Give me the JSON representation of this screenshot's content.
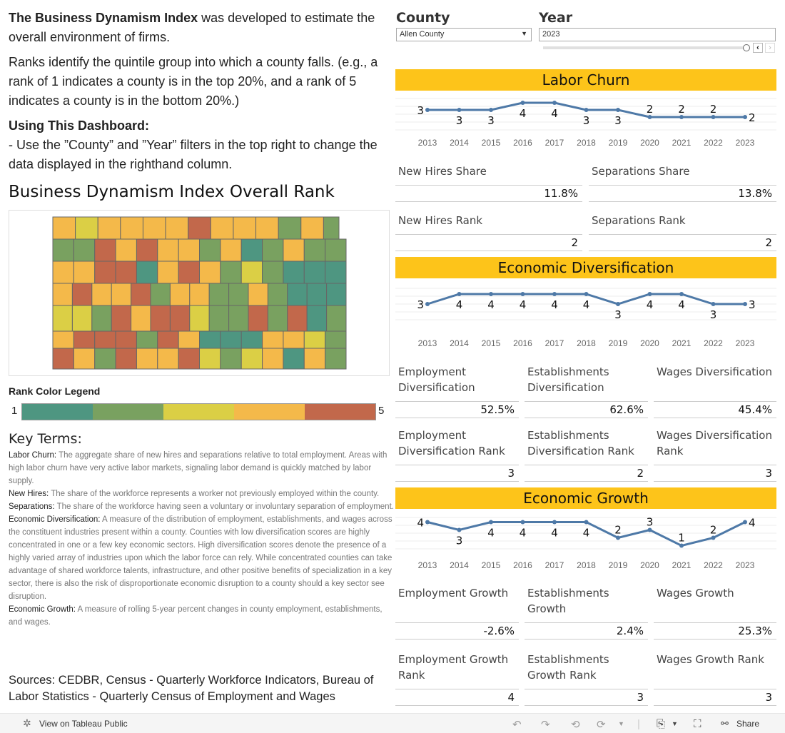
{
  "intro": {
    "p1_bold": "The Business Dynamism Index",
    "p1_rest": " was developed to estimate the overall environment of firms.",
    "p2": "Ranks identify the quintile group into which a county falls. (e.g., a rank of 1 indicates a county is in the top 20%, and a rank of 5 indicates a county is in the bottom 20%.)",
    "p3_bold": "Using This Dashboard:",
    "p3": "- Use the ”County” and ”Year” filters in the top right to change the data displayed in the righthand column."
  },
  "map": {
    "title": "Business Dynamism Index Overall Rank",
    "county_ranks_by_row": [
      [
        4,
        3,
        4,
        4,
        4,
        4,
        5,
        4,
        4,
        4,
        2,
        4,
        2
      ],
      [
        2,
        2,
        5,
        4,
        5,
        4,
        4,
        2,
        4,
        1,
        2,
        4,
        2,
        2
      ],
      [
        4,
        4,
        5,
        5,
        1,
        4,
        5,
        4,
        2,
        3,
        2,
        1,
        1,
        1
      ],
      [
        4,
        5,
        4,
        4,
        5,
        2,
        4,
        4,
        2,
        2,
        4,
        2,
        1,
        1,
        1
      ],
      [
        3,
        3,
        2,
        5,
        4,
        5,
        5,
        3,
        2,
        2,
        5,
        2,
        5,
        1,
        2
      ],
      [
        4,
        5,
        5,
        5,
        2,
        5,
        4,
        1,
        1,
        1,
        4,
        4,
        3,
        2
      ],
      [
        5,
        4,
        2,
        5,
        4,
        4,
        5,
        3,
        2,
        3,
        4,
        1,
        4,
        2
      ]
    ]
  },
  "legend": {
    "title": "Rank Color Legend",
    "low": "1",
    "high": "5",
    "colors": {
      "1": "#4e9681",
      "2": "#79a160",
      "3": "#dbcf45",
      "4": "#f4b94a",
      "5": "#c2684b"
    }
  },
  "key_terms": {
    "title": "Key Terms:",
    "items": [
      {
        "term": "Labor Churn:",
        "def": " The aggregate share of new hires and separations relative to total employment. Areas with high labor churn have very active labor markets, signaling labor demand is quickly matched by labor supply."
      },
      {
        "term": "New Hires:",
        "def": " The share of the workforce represents a worker not previously employed within the county."
      },
      {
        "term": "Separations:",
        "def": " The share of the workforce having seen a voluntary or involuntary separation of employment."
      },
      {
        "term": "Economic Diversification:",
        "def": " A measure of the distribution of employment, establishments, and wages across the constituent industries present within a county. Counties with low diversification scores are highly concentrated in one or a few key economic sectors. High diversification scores denote the presence of a highly varied array of industries upon which the labor force can rely. While concentrated counties can take advantage of shared workforce talents, infrastructure, and other positive benefits of specialization in a key sector, there is also the risk of disproportionate economic disruption to a county should a key sector see disruption."
      },
      {
        "term": "Economic Growth:",
        "def": " A measure of rolling 5-year percent changes in county employment, establishments, and wages."
      }
    ]
  },
  "sources": "Sources: CEDBR, Census - Quarterly Workforce Indicators, Bureau of Labor Statistics - Quarterly Census of Employment and Wages",
  "filters": {
    "county_label": "County",
    "county_value": "Allen County",
    "year_label": "Year",
    "year_value": "2023"
  },
  "years": [
    "2013",
    "2014",
    "2015",
    "2016",
    "2017",
    "2018",
    "2019",
    "2020",
    "2021",
    "2022",
    "2023"
  ],
  "line_color": "#4e79a7",
  "sections": {
    "churn": {
      "title": "Labor Churn",
      "ranks": [
        3,
        3,
        3,
        4,
        4,
        3,
        3,
        2,
        2,
        2,
        2
      ],
      "metrics": [
        {
          "label": "New Hires Share",
          "value": "11.8%"
        },
        {
          "label": "Separations Share",
          "value": "13.8%"
        },
        {
          "label": "New Hires Rank",
          "value": "2"
        },
        {
          "label": "Separations Rank",
          "value": "2"
        }
      ]
    },
    "div": {
      "title": "Economic Diversification",
      "ranks": [
        3,
        4,
        4,
        4,
        4,
        4,
        3,
        4,
        4,
        3,
        3
      ],
      "metrics": [
        {
          "label": "Employment Diversification",
          "value": "52.5%"
        },
        {
          "label": "Establishments Diversification",
          "value": "62.6%"
        },
        {
          "label": "Wages Diversification",
          "value": "45.4%"
        },
        {
          "label": "Employment Diversification Rank",
          "value": "3"
        },
        {
          "label": "Establishments Diversification Rank",
          "value": "2"
        },
        {
          "label": "Wages Diversification Rank",
          "value": "3"
        }
      ]
    },
    "growth": {
      "title": "Economic Growth",
      "ranks": [
        4,
        3,
        4,
        4,
        4,
        4,
        2,
        3,
        1,
        2,
        4
      ],
      "metrics": [
        {
          "label": "Employment Growth",
          "value": "-2.6%"
        },
        {
          "label": "Establishments Growth",
          "value": "2.4%"
        },
        {
          "label": "Wages Growth",
          "value": "25.3%"
        },
        {
          "label": "Employment Growth Rank",
          "value": "4"
        },
        {
          "label": "Establishments Growth Rank",
          "value": "3"
        },
        {
          "label": "Wages Growth Rank",
          "value": "3"
        }
      ]
    }
  },
  "toolbar": {
    "view_label": "View on Tableau Public",
    "share_label": "Share"
  }
}
